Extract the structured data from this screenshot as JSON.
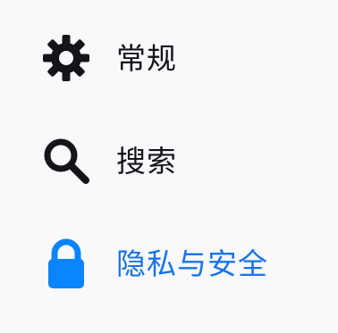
{
  "sidebar": {
    "items": [
      {
        "label": "常规",
        "icon": "gear-icon",
        "selected": false
      },
      {
        "label": "搜索",
        "icon": "search-icon",
        "selected": false
      },
      {
        "label": "隐私与安全",
        "icon": "lock-icon",
        "selected": true
      }
    ]
  },
  "colors": {
    "background": "#f9f9fb",
    "text": "#15141a",
    "accent": "#1a73e8",
    "lock_icon": "#0a84ff"
  }
}
